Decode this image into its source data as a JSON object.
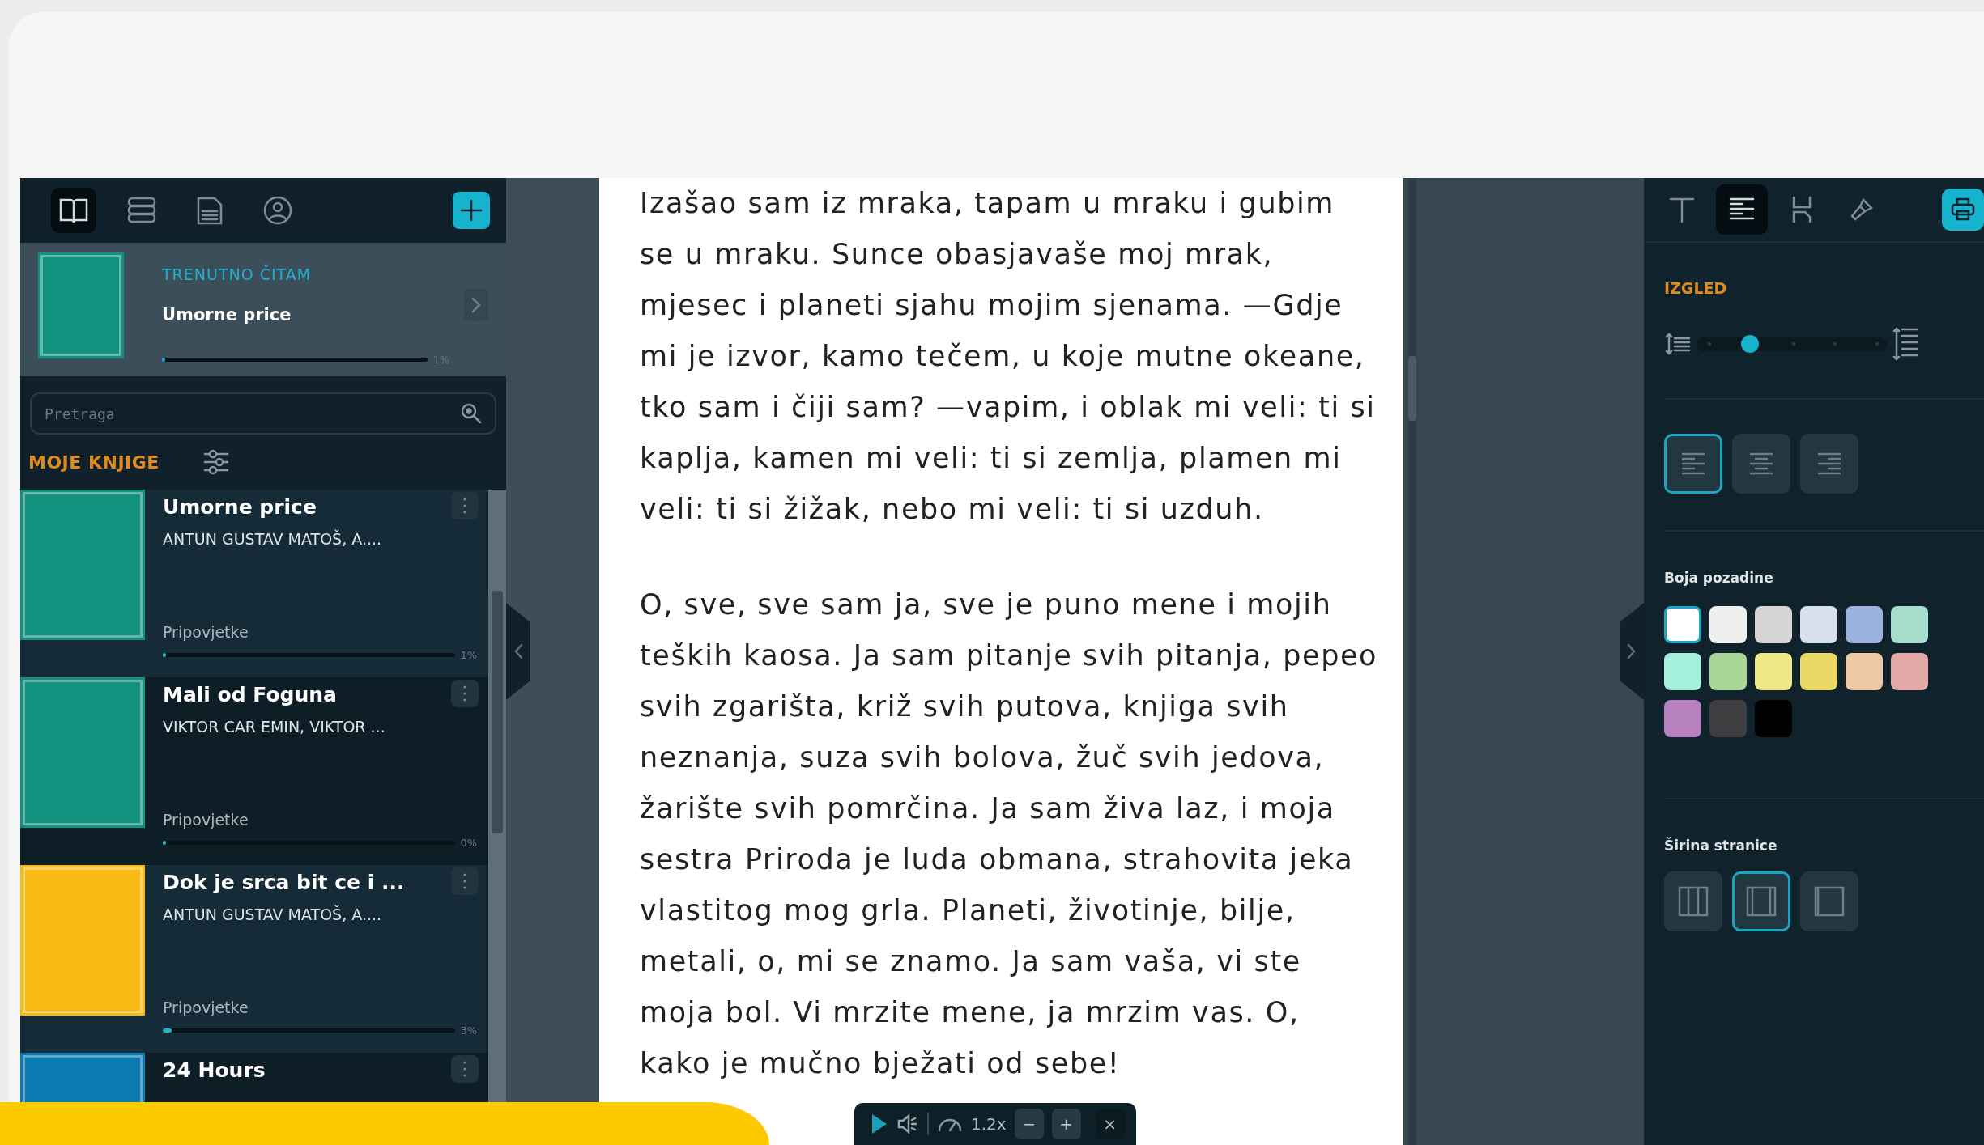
{
  "sidebar": {
    "tabs": [
      {
        "kind": "book",
        "selected": true
      },
      {
        "kind": "stack",
        "selected": false
      },
      {
        "kind": "document",
        "selected": false
      },
      {
        "kind": "profile",
        "selected": false
      }
    ],
    "current": {
      "heading": "TRENUTNO ČITAM",
      "title": "Umorne price",
      "level": 0.01,
      "reading": "1%",
      "color": "#13917f"
    },
    "search": {
      "placeholder": "Pretraga"
    },
    "library": {
      "heading": "MOJE KNJIGE",
      "books": [
        {
          "title": "Umorne price",
          "author": "ANTUN GUSTAV MATOŠ, A....",
          "genre": "Pripovjetke",
          "level": 0.01,
          "reading": "1%",
          "color": "#13917f"
        },
        {
          "title": "Mali od Foguna",
          "author": "VIKTOR CAR EMIN, VIKTOR ...",
          "genre": "Pripovjetke",
          "level": 0,
          "reading": "0%",
          "color": "#13917f"
        },
        {
          "title": "Dok je srca bit ce i ...",
          "author": "ANTUN GUSTAV MATOŠ, A....",
          "genre": "Pripovjetke",
          "level": 0.03,
          "reading": "3%",
          "color": "#f7bb14"
        },
        {
          "title": "24 Hours",
          "color": "#0b7ab0"
        }
      ]
    }
  },
  "page": {
    "paragraphs": [
      "Izašao sam iz mraka, tapam u mraku i gubim se u mraku. Sunce obasjavaše moj mrak, mjesec i planeti sjahu mojim sjenama. —Gdje mi je izvor, kamo tečem, u koje mutne okeane, tko sam i čiji sam? —vapim, i oblak mi veli: ti si kaplja, kamen mi veli: ti si zemlja, plamen mi veli: ti si žižak, nebo mi veli: ti si uzduh.",
      "O, sve, sve sam ja, sve je puno mene i mojih teških kaosa. Ja sam pitanje svih pitanja, pepeo svih zgarišta, križ svih putova, knjiga svih neznanja, suza svih bolova, žuč svih jedova, žarište svih pomrčina. Ja sam živa laz, i moja sestra Priroda je luda obmana, strahovita jeka vlastitog mog grla. Planeti, životinje, bilje, metali, o, mi se znamo. Ja sam vaša, vi ste moja bol. Vi mrzite mene, ja mrzim vas. O, kako je mučno bježati od sebe!"
    ]
  },
  "player": {
    "speed": "1.2x",
    "buttons": [
      {
        "kind": "minus",
        "label": "−"
      },
      {
        "kind": "plus",
        "label": "+"
      },
      {
        "kind": "close",
        "label": "×"
      }
    ]
  },
  "settings": {
    "tabs": [
      {
        "kind": "text",
        "selected": false
      },
      {
        "kind": "layout",
        "selected": true
      },
      {
        "kind": "hyphen",
        "selected": false
      },
      {
        "kind": "brush",
        "selected": false
      }
    ],
    "heading": "IZGLED",
    "line_spacing": {
      "level": 0.25
    },
    "alignment": [
      {
        "kind": "left",
        "selected": true
      },
      {
        "kind": "center",
        "selected": false
      },
      {
        "kind": "right",
        "selected": false
      }
    ],
    "background": {
      "label": "Boja pozadine",
      "swatches": [
        {
          "color": "#ffffff",
          "selected": true
        },
        {
          "color": "#eef0ed",
          "selected": false
        },
        {
          "color": "#d6d5d4",
          "selected": false
        },
        {
          "color": "#d9e1f0",
          "selected": false
        },
        {
          "color": "#9ab2dd",
          "selected": false
        },
        {
          "color": "#a6dccb",
          "selected": false
        },
        {
          "color": "#a5f0dc",
          "selected": false
        },
        {
          "color": "#a7d696",
          "selected": false
        },
        {
          "color": "#f0e98a",
          "selected": false
        },
        {
          "color": "#ecd866",
          "selected": false
        },
        {
          "color": "#edcaa7",
          "selected": false
        },
        {
          "color": "#e3a9a8",
          "selected": false
        },
        {
          "color": "#b781bf",
          "selected": false
        },
        {
          "color": "#3e3e40",
          "selected": false
        },
        {
          "color": "#000000",
          "selected": false
        }
      ]
    },
    "page_width": {
      "label": "Širina stranice",
      "options": [
        {
          "kind": "narrow",
          "selected": false
        },
        {
          "kind": "medium",
          "selected": true
        },
        {
          "kind": "wide",
          "selected": false
        }
      ]
    }
  }
}
